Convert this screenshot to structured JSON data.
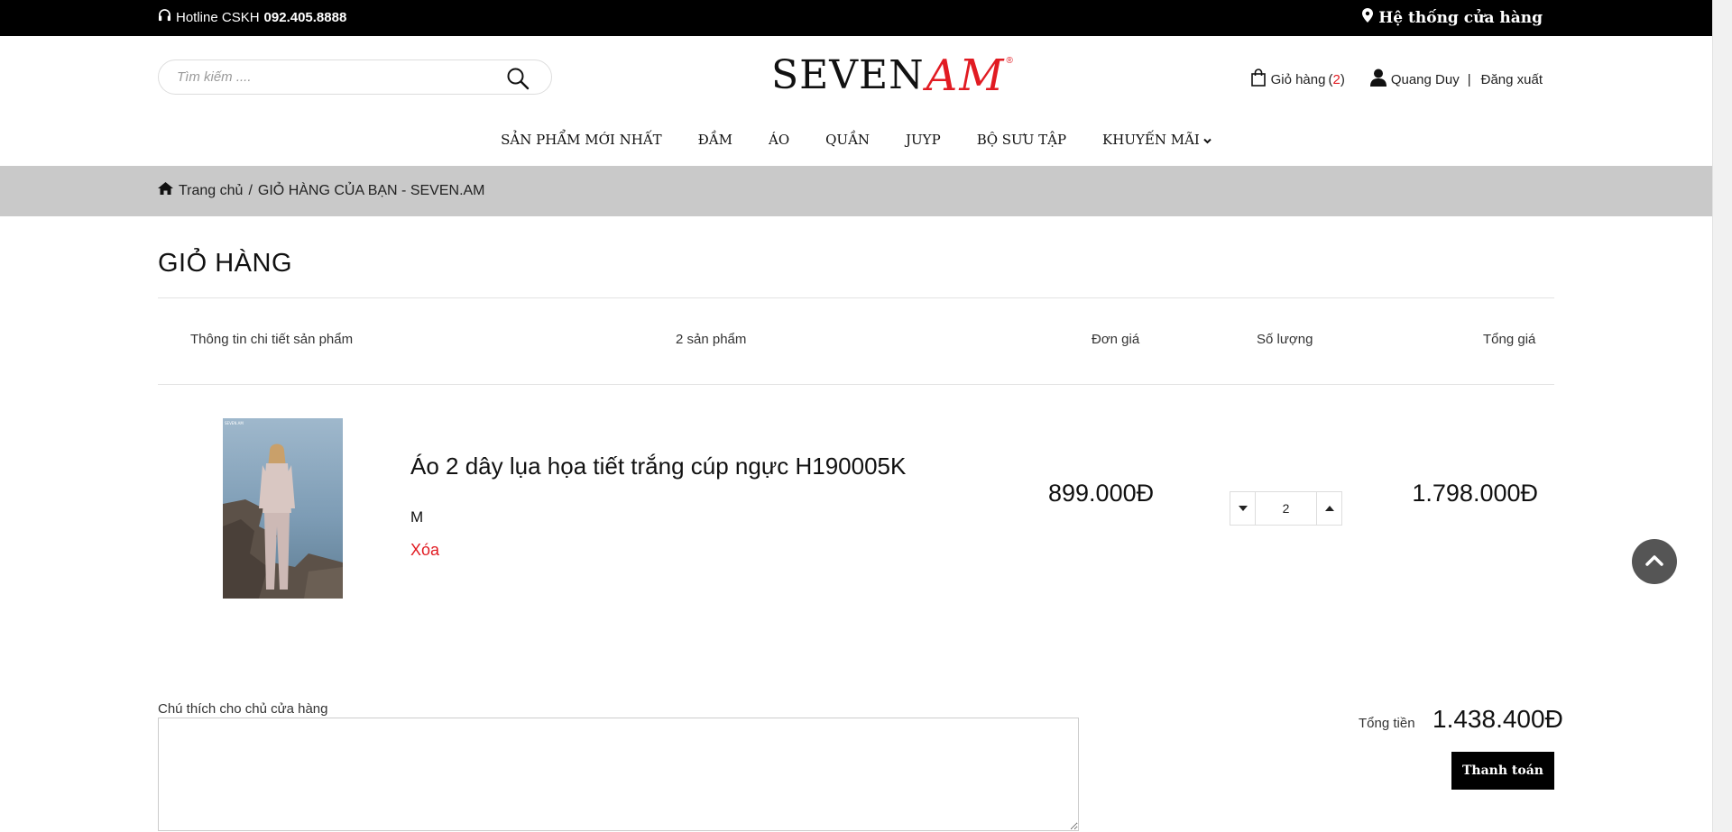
{
  "topbar": {
    "hotline_label": "Hotline CSKH",
    "hotline_number": "092.405.8888",
    "stores_label": "Hệ thống cửa hàng"
  },
  "header": {
    "search_placeholder": "Tìm kiếm ....",
    "logo_main": "SEVEN",
    "logo_accent": "AM",
    "logo_mark": "®",
    "cart_label": "Giỏ hàng",
    "cart_count_open": "(",
    "cart_count": "2",
    "cart_count_close": ")",
    "user_name": "Quang Duy",
    "separator": "|",
    "logout_label": "Đăng xuất"
  },
  "nav": [
    {
      "label": "SẢN PHẨM MỚI NHẤT"
    },
    {
      "label": "ĐẦM"
    },
    {
      "label": "ÁO"
    },
    {
      "label": "QUẦN"
    },
    {
      "label": "JUYP"
    },
    {
      "label": "BỘ SƯU TẬP"
    },
    {
      "label": "KHUYẾN MÃI"
    }
  ],
  "breadcrumb": {
    "home_label": "Trang chủ",
    "separator": "/",
    "current": "GIỎ HÀNG CỦA BẠN - SEVEN.AM"
  },
  "cart": {
    "title": "GIỎ HÀNG",
    "columns": {
      "details": "Thông tin chi tiết sản phẩm",
      "count": "2 sản phẩm",
      "unit_price": "Đơn giá",
      "quantity": "Số lượng",
      "total": "Tổng giá"
    },
    "items": [
      {
        "name": "Áo 2 dây lụa họa tiết trắng cúp ngực H190005K",
        "size": "M",
        "remove_label": "Xóa",
        "unit_price": "899.000Đ",
        "quantity": "2",
        "line_total": "1.798.000Đ"
      }
    ],
    "note_label": "Chú thích cho chủ cửa hàng",
    "note_value": "",
    "summary_label": "Tổng tiền",
    "summary_value": "1.438.400Đ",
    "checkout_label": "Thanh toán"
  },
  "colors": {
    "accent": "#e11b22",
    "topbar_bg": "#000000",
    "breadcrumb_bg": "#c9c9c9",
    "button_bg": "#000000"
  },
  "icons": {
    "hotline": "headphones-icon",
    "stores": "map-marker-icon",
    "search": "search-icon",
    "cart": "shopping-bag-icon",
    "user": "user-icon",
    "home": "home-icon",
    "dropdown": "chevron-down-icon",
    "qty_dec": "caret-down-icon",
    "qty_inc": "caret-up-icon",
    "to_top": "chevron-up-icon"
  }
}
